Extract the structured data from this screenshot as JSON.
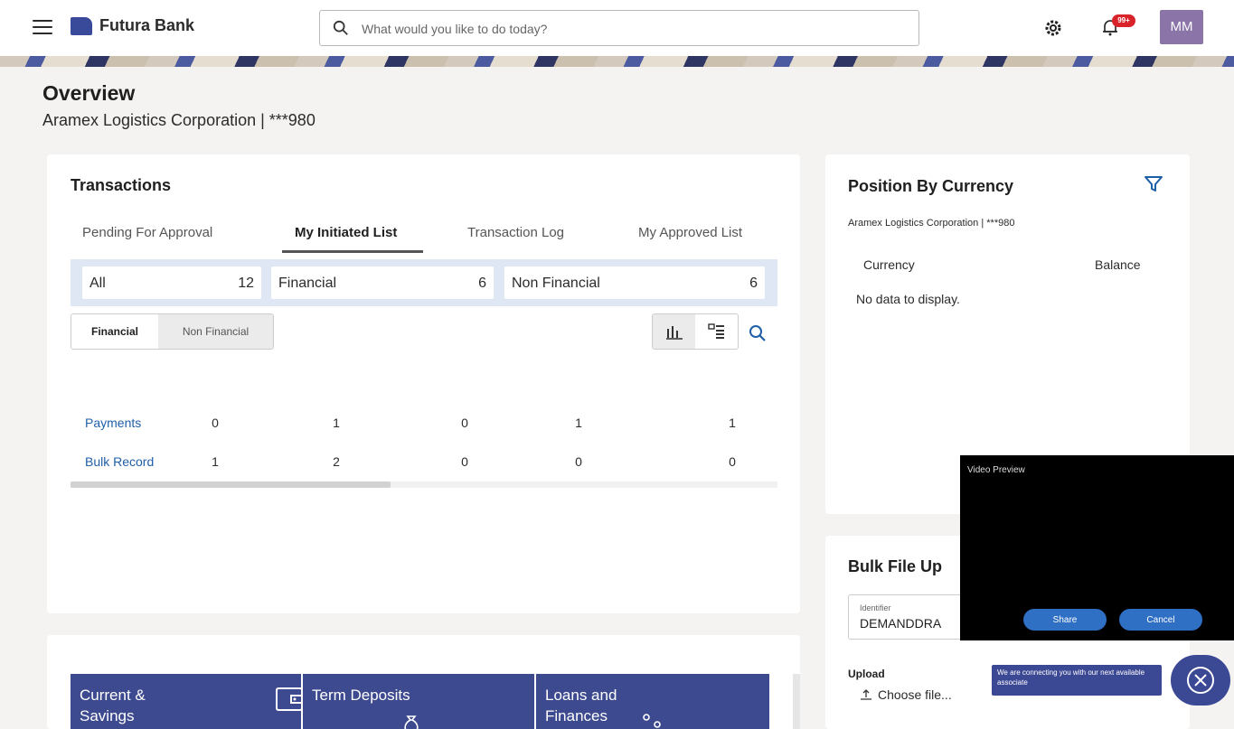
{
  "header": {
    "brand": "Futura Bank",
    "search_placeholder": "What would you like to do today?",
    "notification_badge": "99+",
    "avatar_initials": "MM"
  },
  "page": {
    "title": "Overview",
    "subtitle": "Aramex Logistics Corporation | ***980"
  },
  "transactions": {
    "title": "Transactions",
    "tabs": [
      "Pending For Approval",
      "My Initiated List",
      "Transaction Log",
      "My Approved List"
    ],
    "active_tab": "My Initiated List",
    "summary": [
      {
        "label": "All",
        "count": "12"
      },
      {
        "label": "Financial",
        "count": "6"
      },
      {
        "label": "Non Financial",
        "count": "6"
      }
    ],
    "toggle": {
      "active": "Financial",
      "inactive": "Non Financial"
    },
    "rows": [
      {
        "name": "Payments",
        "values": [
          "0",
          "1",
          "0",
          "1",
          "1"
        ]
      },
      {
        "name": "Bulk Record",
        "values": [
          "1",
          "2",
          "0",
          "0",
          "0"
        ]
      }
    ]
  },
  "position": {
    "title": "Position By Currency",
    "subtitle": "Aramex Logistics Corporation | ***980",
    "col_currency": "Currency",
    "col_balance": "Balance",
    "empty": "No data to display."
  },
  "bulk": {
    "title": "Bulk File Up",
    "identifier_label": "Identifier",
    "identifier_value": "DEMANDDRA",
    "upload_label": "Upload",
    "choose_file": "Choose file..."
  },
  "tiles": [
    {
      "label": "Current & Savings"
    },
    {
      "label": "Term Deposits"
    },
    {
      "label": "Loans and Finances"
    }
  ],
  "video": {
    "title": "Video Preview",
    "share": "Share",
    "cancel": "Cancel",
    "toast": "We are connecting you with our next available associate"
  }
}
